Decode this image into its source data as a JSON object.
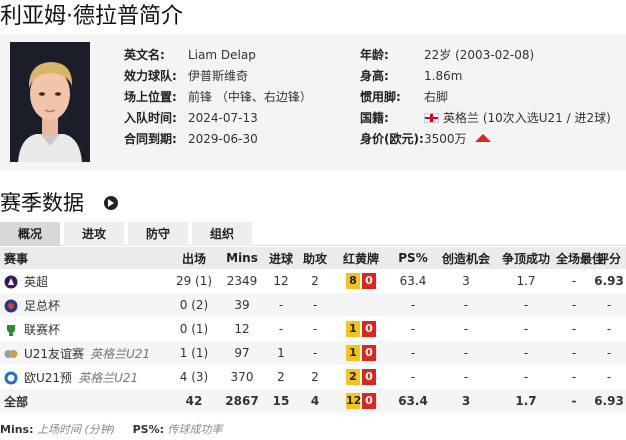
{
  "page_title": "利亚姆·德拉普简介",
  "profile": {
    "fields_left": [
      {
        "label": "英文名:",
        "value": "Liam Delap"
      },
      {
        "label": "效力球队:",
        "value": "伊普斯维奇"
      },
      {
        "label": "场上位置:",
        "value": "前锋 （中锋、右边锋）"
      },
      {
        "label": "入队时间:",
        "value": "2024-07-13"
      },
      {
        "label": "合同到期:",
        "value": "2029-06-30"
      }
    ],
    "age": {
      "label": "年龄:",
      "value": "22岁 (2003-02-08)"
    },
    "height": {
      "label": "身高:",
      "value": "1.86m"
    },
    "foot": {
      "label": "惯用脚:",
      "value": "右脚"
    },
    "nationality": {
      "label": "国籍:",
      "value": "英格兰 (10次入选U21 / 进2球)",
      "flag_icon": "england-flag-icon"
    },
    "value": {
      "label": "身价(欧元):",
      "value": "3500万",
      "trend_icon": "trend-up-icon",
      "trend_color": "#d9291c"
    }
  },
  "season": {
    "title": "赛季数据",
    "tabs": [
      {
        "label": "概况",
        "active": true
      },
      {
        "label": "进攻",
        "active": false
      },
      {
        "label": "防守",
        "active": false
      },
      {
        "label": "组织",
        "active": false
      }
    ],
    "columns": [
      "赛事",
      "出场",
      "Mins",
      "进球",
      "助攻",
      "红黄牌",
      "PS%",
      "创造机会",
      "争顶成功",
      "全场最佳",
      "评分"
    ],
    "rows": [
      {
        "comp": "英超",
        "sub": "",
        "icon": "premier-league-icon",
        "apps": "29 (1)",
        "mins": "2349",
        "goals": "12",
        "assists": "2",
        "yellow": "8",
        "red": "0",
        "ps": "63.4",
        "chances": "3",
        "aerial": "1.7",
        "motm": "-",
        "rating": "6.93"
      },
      {
        "comp": "足总杯",
        "sub": "",
        "icon": "fa-cup-icon",
        "apps": "0 (2)",
        "mins": "39",
        "goals": "-",
        "assists": "-",
        "yellow": "",
        "red": "",
        "ps": "-",
        "chances": "-",
        "aerial": "-",
        "motm": "-",
        "rating": "-"
      },
      {
        "comp": "联赛杯",
        "sub": "",
        "icon": "league-cup-icon",
        "apps": "0 (1)",
        "mins": "12",
        "goals": "-",
        "assists": "-",
        "yellow": "1",
        "red": "0",
        "ps": "-",
        "chances": "-",
        "aerial": "-",
        "motm": "-",
        "rating": "-"
      },
      {
        "comp": "U21友谊赛",
        "sub": "英格兰U21",
        "icon": "friendly-icon",
        "apps": "1 (1)",
        "mins": "97",
        "goals": "1",
        "assists": "-",
        "yellow": "1",
        "red": "0",
        "ps": "-",
        "chances": "-",
        "aerial": "-",
        "motm": "-",
        "rating": "-"
      },
      {
        "comp": "欧U21预",
        "sub": "英格兰U21",
        "icon": "euro-u21-icon",
        "apps": "4 (3)",
        "mins": "370",
        "goals": "2",
        "assists": "2",
        "yellow": "2",
        "red": "0",
        "ps": "-",
        "chances": "-",
        "aerial": "-",
        "motm": "-",
        "rating": "-"
      }
    ],
    "total": {
      "comp": "全部",
      "apps": "42",
      "mins": "2867",
      "goals": "15",
      "assists": "4",
      "yellow": "12",
      "red": "0",
      "ps": "63.4",
      "chances": "3",
      "aerial": "1.7",
      "motm": "-",
      "rating": "6.93"
    }
  },
  "footnote": {
    "mins_label": "Mins:",
    "mins_desc": "上场时间 (分钟)",
    "ps_label": "PS%:",
    "ps_desc": "传球成功率"
  },
  "colors": {
    "accent_red": "#d9291c",
    "yellow_card": "#f6c21c",
    "red_card": "#d9291c"
  }
}
